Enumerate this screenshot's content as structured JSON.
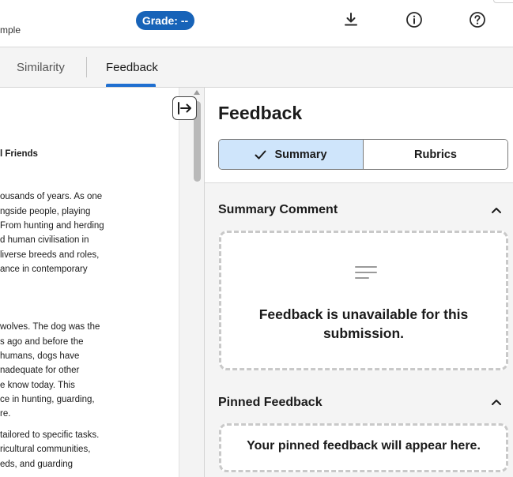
{
  "header": {
    "doc_name": "mple",
    "grade_label": "Grade: --",
    "icons": [
      "download-icon",
      "info-icon",
      "help-icon"
    ]
  },
  "tabs": [
    {
      "label": "Similarity",
      "active": false
    },
    {
      "label": "Feedback",
      "active": true
    }
  ],
  "document": {
    "lines": [
      {
        "text": "l Friends",
        "bold": true
      },
      {
        "text": "ousands of years. As one"
      },
      {
        "text": "ngside people, playing"
      },
      {
        "text": "From hunting and herding"
      },
      {
        "text": "d human civilisation in"
      },
      {
        "text": "liverse breeds and roles,"
      },
      {
        "text": "ance in contemporary"
      },
      {
        "text": "wolves. The dog was the"
      },
      {
        "text": "s ago and before the"
      },
      {
        "text": "humans, dogs have"
      },
      {
        "text": "nadequate for other"
      },
      {
        "text": "e know today. This"
      },
      {
        "text": "ce in hunting, guarding,"
      },
      {
        "text": "re."
      },
      {
        "text": "tailored to specific tasks."
      },
      {
        "text": "ricultural communities,"
      },
      {
        "text": "eds, and guarding"
      }
    ]
  },
  "panel": {
    "title": "Feedback",
    "segments": [
      {
        "label": "Summary",
        "active": true
      },
      {
        "label": "Rubrics",
        "active": false
      }
    ],
    "summary_section": {
      "title": "Summary Comment",
      "empty_message": "Feedback is unavailable for this submission."
    },
    "pinned_section": {
      "title": "Pinned Feedback",
      "empty_message": "Your pinned feedback will appear here."
    }
  },
  "colors": {
    "accent": "#1f6fd0",
    "grade_pill": "#1763b8",
    "segment_active": "#cfe5fb"
  }
}
